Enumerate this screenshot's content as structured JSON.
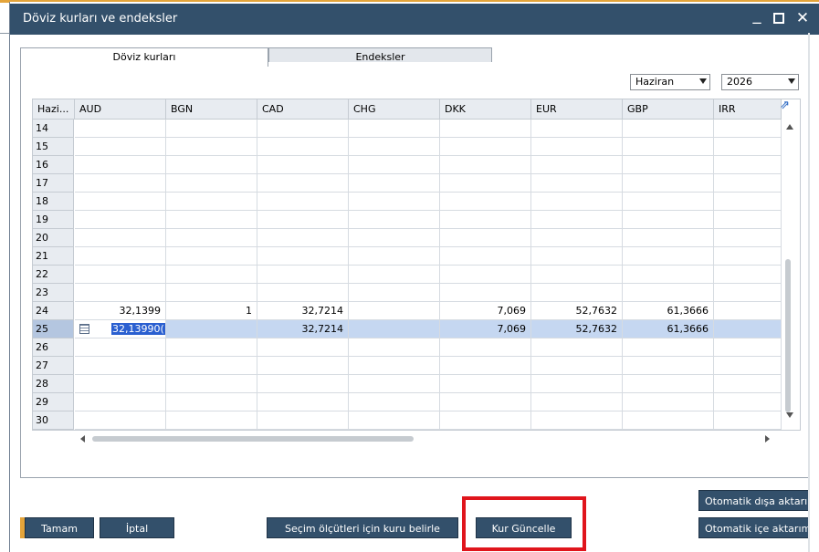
{
  "window": {
    "title": "Döviz kurları ve endeksler"
  },
  "tabs": [
    {
      "label": "Döviz kurları",
      "active": true
    },
    {
      "label": "Endeksler",
      "active": false
    }
  ],
  "filters": {
    "month": "Haziran",
    "year": "2026"
  },
  "grid": {
    "columns": [
      "Hazi...",
      "AUD",
      "BGN",
      "CAD",
      "CHG",
      "DKK",
      "EUR",
      "GBP",
      "IRR"
    ],
    "rows": [
      {
        "day": "14",
        "values": [
          "",
          "",
          "",
          "",
          "",
          "",
          "",
          ""
        ]
      },
      {
        "day": "15",
        "values": [
          "",
          "",
          "",
          "",
          "",
          "",
          "",
          ""
        ]
      },
      {
        "day": "16",
        "values": [
          "",
          "",
          "",
          "",
          "",
          "",
          "",
          ""
        ]
      },
      {
        "day": "17",
        "values": [
          "",
          "",
          "",
          "",
          "",
          "",
          "",
          ""
        ]
      },
      {
        "day": "18",
        "values": [
          "",
          "",
          "",
          "",
          "",
          "",
          "",
          ""
        ]
      },
      {
        "day": "19",
        "values": [
          "",
          "",
          "",
          "",
          "",
          "",
          "",
          ""
        ]
      },
      {
        "day": "20",
        "values": [
          "",
          "",
          "",
          "",
          "",
          "",
          "",
          ""
        ]
      },
      {
        "day": "21",
        "values": [
          "",
          "",
          "",
          "",
          "",
          "",
          "",
          ""
        ]
      },
      {
        "day": "22",
        "values": [
          "",
          "",
          "",
          "",
          "",
          "",
          "",
          ""
        ]
      },
      {
        "day": "23",
        "values": [
          "",
          "",
          "",
          "",
          "",
          "",
          "",
          ""
        ]
      },
      {
        "day": "24",
        "values": [
          "32,1399",
          "1",
          "32,7214",
          "",
          "7,069",
          "52,7632",
          "61,3666",
          ""
        ]
      },
      {
        "day": "25",
        "values": [
          "32,13990(",
          "",
          "32,7214",
          "",
          "7,069",
          "52,7632",
          "61,3666",
          ""
        ],
        "selected": true
      },
      {
        "day": "26",
        "values": [
          "",
          "",
          "",
          "",
          "",
          "",
          "",
          ""
        ]
      },
      {
        "day": "27",
        "values": [
          "",
          "",
          "",
          "",
          "",
          "",
          "",
          ""
        ]
      },
      {
        "day": "28",
        "values": [
          "",
          "",
          "",
          "",
          "",
          "",
          "",
          ""
        ]
      },
      {
        "day": "29",
        "values": [
          "",
          "",
          "",
          "",
          "",
          "",
          "",
          ""
        ]
      },
      {
        "day": "30",
        "values": [
          "",
          "",
          "",
          "",
          "",
          "",
          "",
          ""
        ]
      }
    ]
  },
  "buttons": {
    "ok": "Tamam",
    "cancel": "İptal",
    "selection_rate": "Seçim ölçütleri için kuru belirle",
    "update_rate": "Kur Güncelle",
    "auto_export": "Otomatik dışa aktarım",
    "auto_import": "Otomatik içe aktarım"
  },
  "colors": {
    "titlebar": "#33506b",
    "accent": "#e4a43a",
    "selection": "#c5d7f1",
    "highlight": "#e0151c"
  }
}
